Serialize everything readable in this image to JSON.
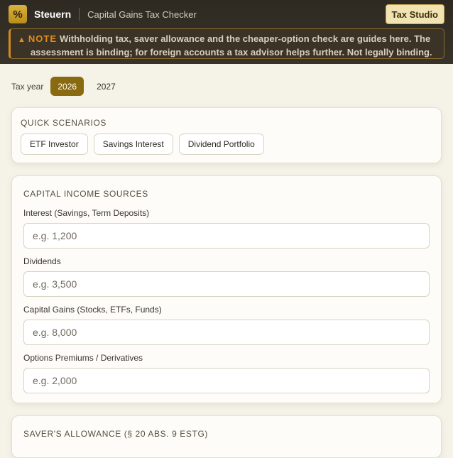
{
  "header": {
    "logo_glyph": "%",
    "brand": "Steuern",
    "app_title": "Capital Gains Tax Checker",
    "studio_button": "Tax Studio"
  },
  "note": {
    "icon": "warning-icon",
    "label": "NOTE",
    "line1": "Withholding tax, saver allowance and the cheaper-option check are guides here. The",
    "line2": "assessment is binding; for foreign accounts a tax advisor helps further. Not legally binding."
  },
  "tax_year": {
    "label": "Tax year",
    "options": [
      "2026",
      "2027"
    ],
    "selected": "2026"
  },
  "quick_scenarios": {
    "title": "QUICK SCENARIOS",
    "chips": [
      "ETF Investor",
      "Savings Interest",
      "Dividend Portfolio"
    ]
  },
  "sources": {
    "title": "CAPITAL INCOME SOURCES",
    "fields": [
      {
        "label": "Interest (Savings, Term Deposits)",
        "placeholder": "e.g. 1,200",
        "value": ""
      },
      {
        "label": "Dividends",
        "placeholder": "e.g. 3,500",
        "value": ""
      },
      {
        "label": "Capital Gains (Stocks, ETFs, Funds)",
        "placeholder": "e.g. 8,000",
        "value": ""
      },
      {
        "label": "Options Premiums / Derivatives",
        "placeholder": "e.g. 2,000",
        "value": ""
      }
    ]
  },
  "allowance": {
    "title": "SAVER'S ALLOWANCE (§ 20 ABS. 9 ESTG)"
  },
  "colors": {
    "accent": "#8a6a10",
    "warning": "#e28b1c",
    "header_bg": "#2e2a22",
    "page_bg": "#f5f2e8"
  }
}
